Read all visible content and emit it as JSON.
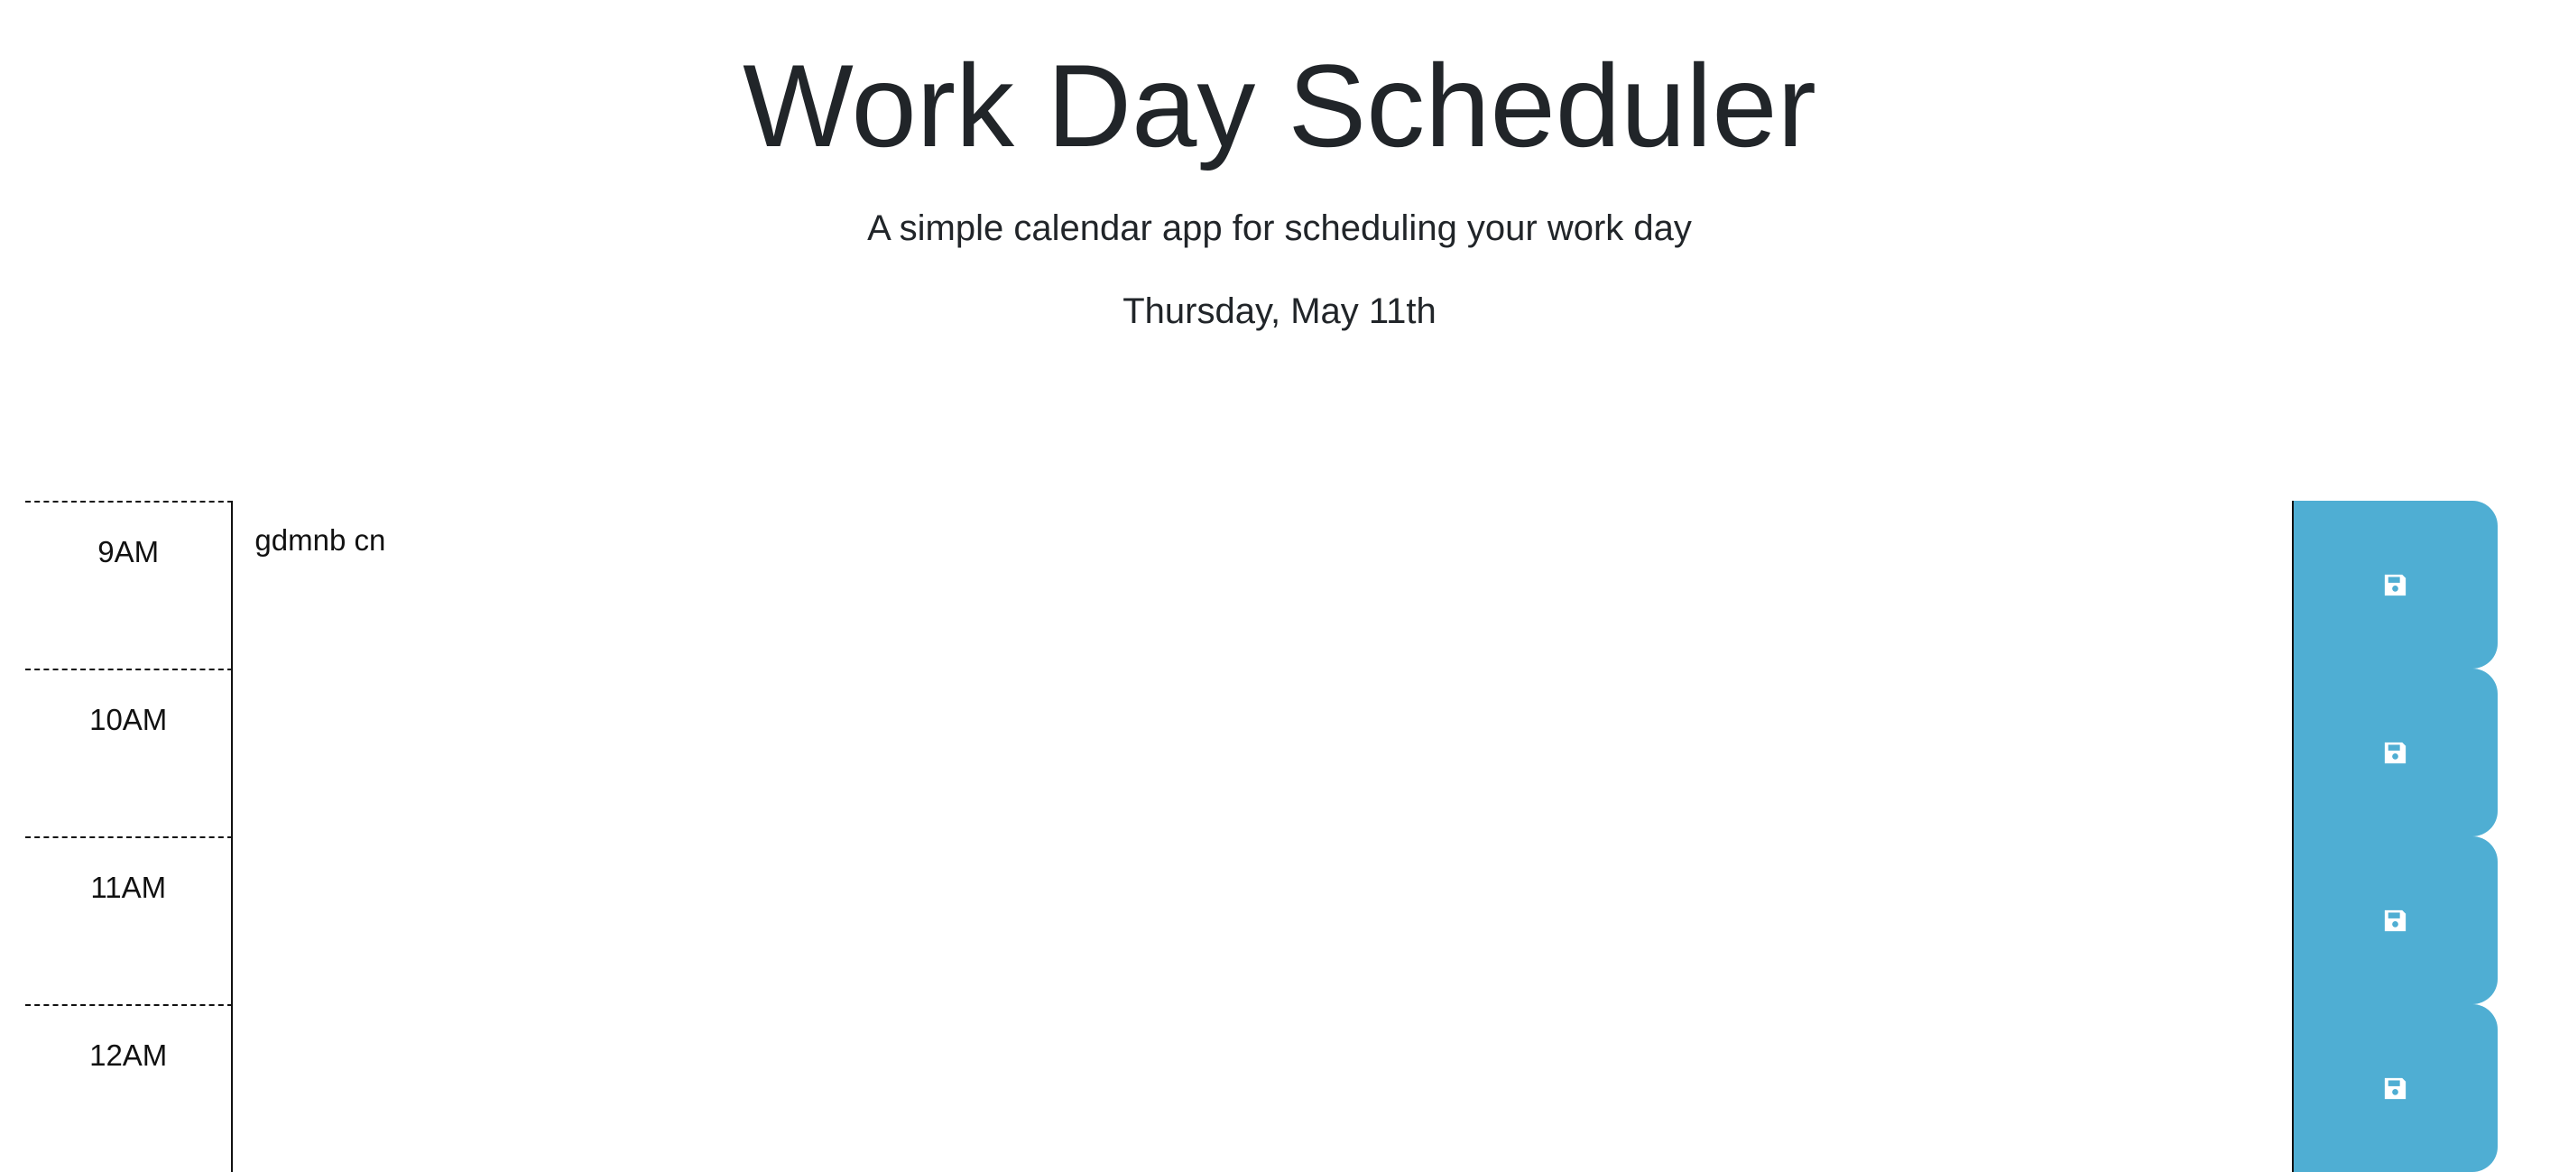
{
  "header": {
    "title": "Work Day Scheduler",
    "subtitle": "A simple calendar app for scheduling your work day",
    "current_day": "Thursday, May 11th"
  },
  "theme": {
    "save_button_color": "#4faed3",
    "text_color": "#212529"
  },
  "schedule": {
    "blocks": [
      {
        "hour": "9AM",
        "description": "gdmnb cn",
        "save_icon": "save-icon"
      },
      {
        "hour": "10AM",
        "description": "",
        "save_icon": "save-icon"
      },
      {
        "hour": "11AM",
        "description": "",
        "save_icon": "save-icon"
      },
      {
        "hour": "12AM",
        "description": "",
        "save_icon": "save-icon"
      }
    ]
  }
}
